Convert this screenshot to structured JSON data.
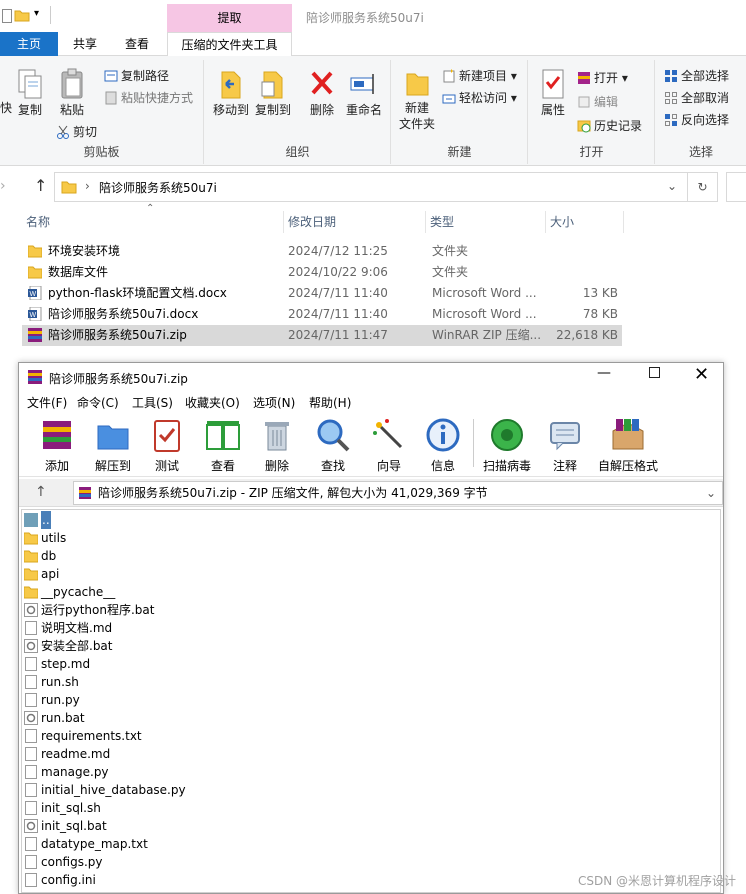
{
  "explorer": {
    "context_tab": "提取",
    "window_title": "陪诊师服务系统50u7i",
    "tabs": [
      "主页",
      "共享",
      "查看",
      "压缩的文件夹工具"
    ],
    "ribbon": {
      "clipboard": {
        "label": "剪贴板",
        "copy": "复制",
        "paste": "粘贴",
        "copy_path": "复制路径",
        "paste_shortcut": "粘贴快捷方式",
        "cut": "剪切",
        "left_cut": "快"
      },
      "organize": {
        "label": "组织",
        "move_to": "移动到",
        "copy_to": "复制到",
        "delete": "删除",
        "rename": "重命名"
      },
      "new": {
        "label": "新建",
        "new_folder_1": "新建",
        "new_folder_2": "文件夹",
        "new_item": "新建项目",
        "easy_access": "轻松访问"
      },
      "open": {
        "label": "打开",
        "properties": "属性",
        "open": "打开",
        "edit": "编辑",
        "history": "历史记录"
      },
      "select": {
        "label": "选择",
        "select_all": "全部选择",
        "select_none": "全部取消",
        "invert": "反向选择"
      }
    },
    "address": "陪诊师服务系统50u7i",
    "columns": [
      "名称",
      "修改日期",
      "类型",
      "大小"
    ],
    "files": [
      {
        "name": "环境安装环境",
        "date": "2024/7/12 11:25",
        "type": "文件夹",
        "size": "",
        "kind": "folder"
      },
      {
        "name": "数据库文件",
        "date": "2024/10/22 9:06",
        "type": "文件夹",
        "size": "",
        "kind": "folder"
      },
      {
        "name": "python-flask环境配置文档.docx",
        "date": "2024/7/11 11:40",
        "type": "Microsoft Word ...",
        "size": "13 KB",
        "kind": "word"
      },
      {
        "name": "陪诊师服务系统50u7i.docx",
        "date": "2024/7/11 11:40",
        "type": "Microsoft Word ...",
        "size": "78 KB",
        "kind": "word"
      },
      {
        "name": "陪诊师服务系统50u7i.zip",
        "date": "2024/7/11 11:47",
        "type": "WinRAR ZIP 压缩...",
        "size": "22,618 KB",
        "kind": "zip"
      }
    ]
  },
  "winrar": {
    "title": "陪诊师服务系统50u7i.zip",
    "menu": [
      "文件(F)",
      "命令(C)",
      "工具(S)",
      "收藏夹(O)",
      "选项(N)",
      "帮助(H)"
    ],
    "toolbar": [
      "添加",
      "解压到",
      "测试",
      "查看",
      "删除",
      "查找",
      "向导",
      "信息",
      "扫描病毒",
      "注释",
      "自解压格式"
    ],
    "path": "陪诊师服务系统50u7i.zip - ZIP 压缩文件, 解包大小为 41,029,369 字节",
    "items": [
      {
        "name": "..",
        "kind": "up"
      },
      {
        "name": "utils",
        "kind": "folder"
      },
      {
        "name": "db",
        "kind": "folder"
      },
      {
        "name": "api",
        "kind": "folder"
      },
      {
        "name": "__pycache__",
        "kind": "folder"
      },
      {
        "name": "运行python程序.bat",
        "kind": "bat"
      },
      {
        "name": "说明文档.md",
        "kind": "file"
      },
      {
        "name": "安装全部.bat",
        "kind": "bat"
      },
      {
        "name": "step.md",
        "kind": "file"
      },
      {
        "name": "run.sh",
        "kind": "file"
      },
      {
        "name": "run.py",
        "kind": "file"
      },
      {
        "name": "run.bat",
        "kind": "bat"
      },
      {
        "name": "requirements.txt",
        "kind": "file"
      },
      {
        "name": "readme.md",
        "kind": "file"
      },
      {
        "name": "manage.py",
        "kind": "file"
      },
      {
        "name": "initial_hive_database.py",
        "kind": "file"
      },
      {
        "name": "init_sql.sh",
        "kind": "file"
      },
      {
        "name": "init_sql.bat",
        "kind": "bat"
      },
      {
        "name": "datatype_map.txt",
        "kind": "file"
      },
      {
        "name": "configs.py",
        "kind": "file"
      },
      {
        "name": "config.ini",
        "kind": "file"
      }
    ]
  },
  "watermark": "CSDN @米恩计算机程序设计"
}
